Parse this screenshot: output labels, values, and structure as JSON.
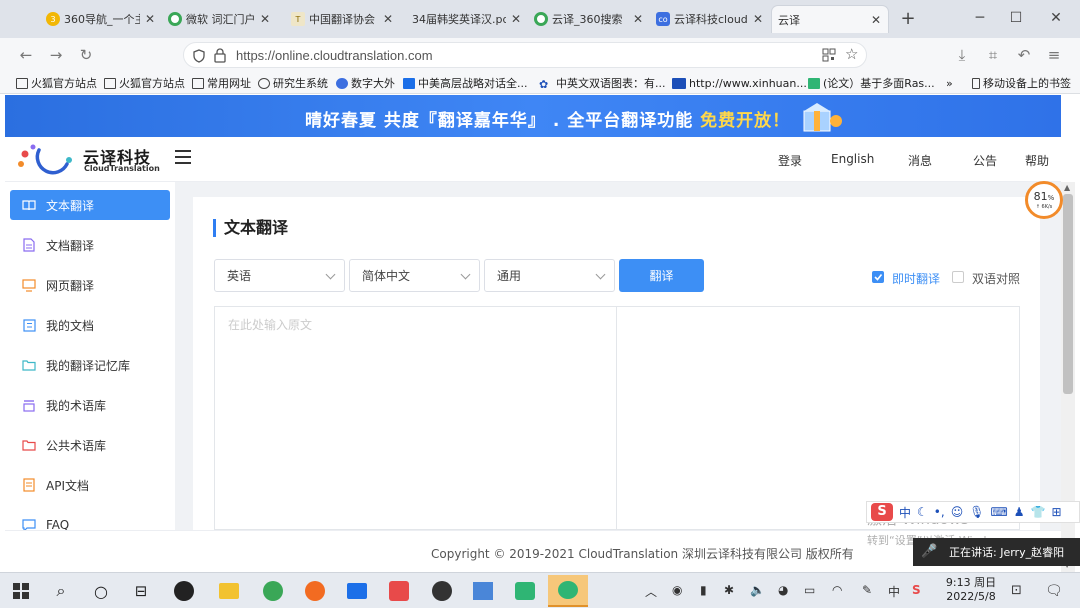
{
  "browser": {
    "tabs": [
      {
        "title": "360导航_一个主",
        "color": "#f2b705"
      },
      {
        "title": "微软 词汇门户_",
        "color": "#3aa757"
      },
      {
        "title": "中国翻译协会",
        "color": "#b8a15a"
      },
      {
        "title": "34届韩奖英译汉.pdf",
        "color": ""
      },
      {
        "title": "云译_360搜索",
        "color": "#3aa757"
      },
      {
        "title": "云译科技cloudt",
        "color": "#3d6fe0"
      },
      {
        "title": "云译",
        "color": ""
      }
    ],
    "new_tab": "+",
    "url": "https://online.cloudtranslation.com",
    "bookmarks": [
      "火狐官方站点",
      "火狐官方站点",
      "常用网址",
      "研究生系统",
      "数字大外",
      "中美高层战略对话全...",
      "中英文双语图表：有...",
      "http://www.xinhuan...",
      "(论文）基于多面Ras...",
      "移动设备上的书签"
    ],
    "bookmarks_overflow": "»"
  },
  "site": {
    "banner": {
      "part1": "晴好春夏  共度『翻译嘉年华』 . 全平台翻译功能 ",
      "highlight": "免费开放！"
    },
    "logo": {
      "name": "云译科技",
      "sub": "CloudTranslation"
    },
    "nav": [
      "登录",
      "English",
      "消息",
      "公告",
      "帮助"
    ],
    "sidebar": [
      {
        "label": "文本翻译",
        "icon": "book-icon",
        "color": "#ffffff"
      },
      {
        "label": "文档翻译",
        "icon": "document-icon",
        "color": "#8a6cf0"
      },
      {
        "label": "网页翻译",
        "icon": "monitor-icon",
        "color": "#f28b2a"
      },
      {
        "label": "我的文档",
        "icon": "file-list-icon",
        "color": "#3d8ff5"
      },
      {
        "label": "我的翻译记忆库",
        "icon": "folder-icon",
        "color": "#3db8c8"
      },
      {
        "label": "我的术语库",
        "icon": "library-icon",
        "color": "#8a6cf0"
      },
      {
        "label": "公共术语库",
        "icon": "folder-icon",
        "color": "#e84a4a"
      },
      {
        "label": "API文档",
        "icon": "api-doc-icon",
        "color": "#f28b2a"
      },
      {
        "label": "FAQ",
        "icon": "chat-icon",
        "color": "#3d8ff5"
      }
    ],
    "main": {
      "title": "文本翻译",
      "source_lang": "英语",
      "target_lang": "简体中文",
      "domain": "通用",
      "translate_btn": "翻译",
      "instant_label": "即时翻译",
      "instant_checked": true,
      "bilingual_label": "双语对照",
      "bilingual_checked": false,
      "source_placeholder": "在此处输入原文"
    },
    "footer": "Copyright © 2019-2021 CloudTranslation 深圳云译科技有限公司 版权所有"
  },
  "overlay": {
    "gauge_value": "81",
    "gauge_unit": "%",
    "gauge_sub": "↑ 6K/s",
    "activate_line1": "激活 Windows",
    "activate_line2": "转到“设置”以激活 Windows。",
    "speaking": "正在讲话: Jerry_赵睿阳",
    "ime": "中"
  },
  "taskbar": {
    "time": "9:13 周日",
    "date": "2022/5/8",
    "tray_ime": "中"
  }
}
